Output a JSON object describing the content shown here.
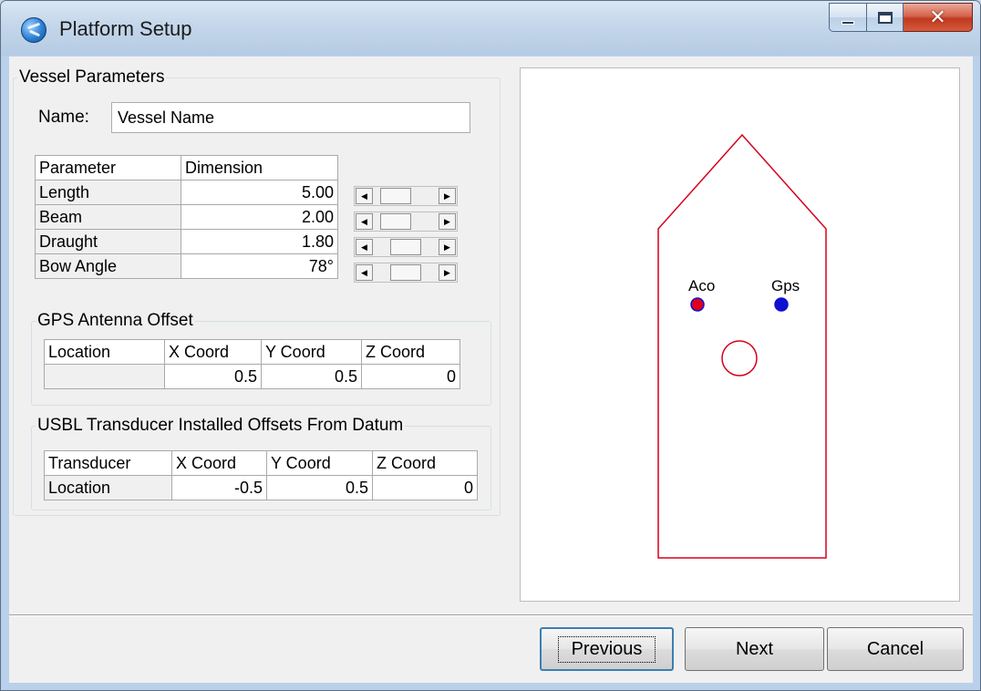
{
  "window": {
    "title": "Platform Setup"
  },
  "vessel": {
    "group_label": "Vessel Parameters",
    "name_label": "Name:",
    "name_value": "Vessel Name",
    "table": {
      "headers": [
        "Parameter",
        "Dimension"
      ],
      "rows": [
        {
          "parameter": "Length",
          "dimension": "5.00",
          "slider_position": 0.2
        },
        {
          "parameter": "Beam",
          "dimension": "2.00",
          "slider_position": 0.2
        },
        {
          "parameter": "Draught",
          "dimension": "1.80",
          "slider_position": 0.5
        },
        {
          "parameter": "Bow Angle",
          "dimension": "78°",
          "slider_position": 0.5
        }
      ]
    }
  },
  "gps": {
    "group_label": "GPS Antenna Offset",
    "headers": [
      "Location",
      "X Coord",
      "Y Coord",
      "Z Coord"
    ],
    "row": {
      "location": "",
      "x": "0.5",
      "y": "0.5",
      "z": "0"
    }
  },
  "usbl": {
    "group_label": "USBL Transducer Installed Offsets From Datum",
    "headers": [
      "Transducer",
      "X Coord",
      "Y Coord",
      "Z Coord"
    ],
    "row": {
      "transducer": "Location",
      "x": "-0.5",
      "y": "0.5",
      "z": "0"
    }
  },
  "preview": {
    "aco_label": "Aco",
    "gps_label": "Gps",
    "hull_color": "#d6001c",
    "aco_color": "#e0001e",
    "gps_color": "#1010d0"
  },
  "buttons": {
    "previous": "Previous",
    "next": "Next",
    "cancel": "Cancel"
  }
}
